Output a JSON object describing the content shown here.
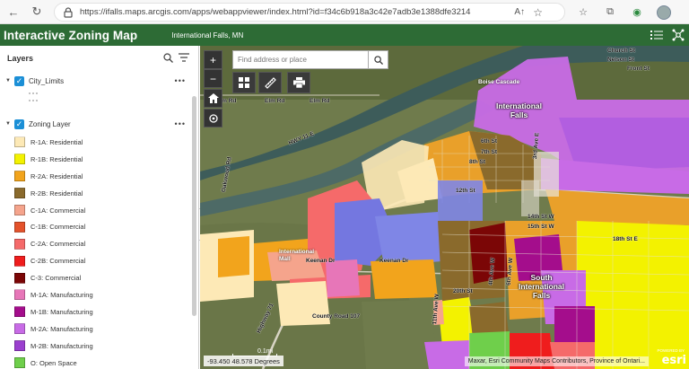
{
  "browser": {
    "url": "https://ifalls.maps.arcgis.com/apps/webappviewer/index.html?id=f34c6b918a3c42e7adb3e1388dfe3214"
  },
  "app": {
    "title": "Interactive Zoning Map",
    "subtitle": "International Falls, MN"
  },
  "layers_panel": {
    "title": "Layers",
    "layers": [
      {
        "label": "City_Limits"
      },
      {
        "label": "Zoning Layer"
      }
    ],
    "legend": [
      {
        "label": "R-1A: Residential",
        "color": "#fde9b6"
      },
      {
        "label": "R-1B: Residential",
        "color": "#f3f200"
      },
      {
        "label": "R-2A: Residential",
        "color": "#f2a41c"
      },
      {
        "label": "R-2B: Residential",
        "color": "#8a6a2c"
      },
      {
        "label": "C-1A: Commercial",
        "color": "#f5a48c"
      },
      {
        "label": "C-1B: Commercial",
        "color": "#e4522b"
      },
      {
        "label": "C-2A: Commercial",
        "color": "#f56a6a"
      },
      {
        "label": "C-2B: Commercial",
        "color": "#ef1d1d"
      },
      {
        "label": "C-3: Commercial",
        "color": "#7b0606"
      },
      {
        "label": "M-1A: Manufacturing",
        "color": "#e776b8"
      },
      {
        "label": "M-1B: Manufacturing",
        "color": "#a40d8c"
      },
      {
        "label": "M-2A: Manufacturing",
        "color": "#c86be6"
      },
      {
        "label": "M-2B: Manufacturing",
        "color": "#9b3fcf"
      },
      {
        "label": "O: Open Space",
        "color": "#6fcf4b"
      }
    ]
  },
  "map": {
    "search_placeholder": "Find address or place",
    "coordinates": "-93.450 48.578 Degrees",
    "scale_label": "0.1mi",
    "attribution": "Maxar, Esri Community Maps Contributors, Province of Ontari...",
    "esri_powered": "POWERED BY",
    "esri_logo": "esri",
    "labels": {
      "int_falls": "International\nFalls",
      "south_int_falls": "South\nInternational\nFalls",
      "boise": "Boise Cascade",
      "intl_mall": "International\nMall",
      "elm_rd_1": "Elm Rd",
      "elm_rd_2": "Elm Rd",
      "elm_rd_3": "Elm Rd",
      "hwy11": "HWY 11 E",
      "oakwood": "Oakwood Rd",
      "keenan": "Keenan Dr",
      "county_rd": "County Road 107",
      "hwy71": "Highway 71",
      "church": "Church St",
      "nelson": "Nelson St",
      "front": "Front St",
      "sixth": "6th St",
      "seventh": "7th St",
      "eighth": "8th St",
      "fourteenth": "14th St W",
      "fifteenth": "15th St W",
      "eighteenth": "18th St E",
      "twentieth": "20th St",
      "third_ave": "3rd Ave E",
      "fourth_ave": "4th Ave W",
      "sixth_ave": "6th Ave W",
      "eleventh_ave": "11th Ave W",
      "twelfth": "12th St"
    }
  }
}
